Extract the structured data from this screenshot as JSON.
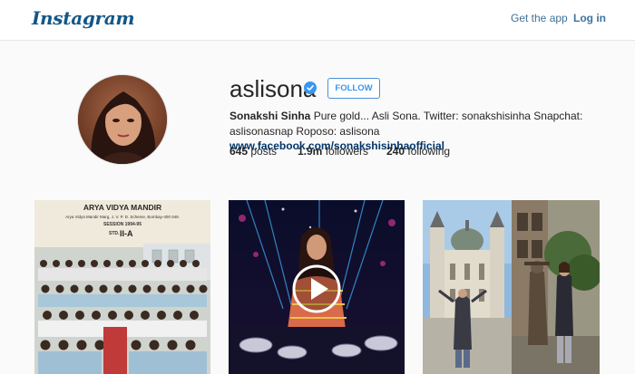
{
  "header": {
    "logo": "Instagram",
    "get_app": "Get the app",
    "login": "Log in"
  },
  "profile": {
    "username": "aslisona",
    "follow_label": "FOLLOW",
    "full_name": "Sonakshi Sinha",
    "bio_text": " Pure gold... Asli Sona. Twitter: sonakshisinha Snapchat: aslisonasnap Roposo: aslisona ",
    "link": "www.facebook.com/sonakshisinhaofficial",
    "stats": {
      "posts_count": "645",
      "posts_label": " posts",
      "followers_count": "1.9m",
      "followers_label": " followers",
      "following_count": "240",
      "following_label": " following"
    }
  },
  "posts": {
    "school_photo": {
      "title": "ARYA VIDYA MANDIR",
      "address": "Arya Vidya Mandir Marg, J. V. P. D. Scheme, Bombay-400 049.",
      "session": "SESSION 1994-95",
      "std_label": "STD.",
      "std_value": "II-A"
    }
  },
  "colors": {
    "accent_link": "#3f729b",
    "follow_blue": "#3897f0",
    "verified_blue": "#3897f0"
  },
  "icons": {
    "verified": "verified-badge-icon",
    "play": "play-icon"
  }
}
